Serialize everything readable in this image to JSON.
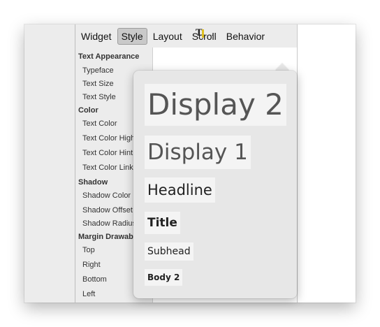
{
  "tabs": [
    {
      "label": "Widget"
    },
    {
      "label": "Style",
      "active": true
    },
    {
      "label": "Layout"
    },
    {
      "label": "Scroll"
    },
    {
      "label": "Behavior"
    }
  ],
  "properties": {
    "text_appearance": {
      "title": "Text Appearance",
      "items": [
        "Typeface",
        "Text Size",
        "Text Style"
      ]
    },
    "color": {
      "title": "Color",
      "items": [
        "Text Color",
        "Text Color High",
        "Text Color Hint",
        "Text Color Link"
      ]
    },
    "shadow": {
      "title": "Shadow",
      "items": [
        "Shadow Color",
        "Shadow Offset",
        "Shadow Radius"
      ]
    },
    "margin_drawable": {
      "title": "Margin Drawabl",
      "items": [
        "Top",
        "Right",
        "Bottom",
        "Left"
      ]
    }
  },
  "value_area": {
    "more_label": "…",
    "icons": [
      "text-appearance-icon",
      "more-icon"
    ]
  },
  "popup": {
    "options": [
      {
        "label": "Display 2"
      },
      {
        "label": "Display 1"
      },
      {
        "label": "Headline"
      },
      {
        "label": "Title"
      },
      {
        "label": "Subhead"
      },
      {
        "label": "Body 2"
      }
    ]
  },
  "colors": {
    "panel_bg": "#ececec",
    "popup_bg": "#e7e7e7",
    "option_bg": "#f4f4f4",
    "active_tab_bg": "#c9c9c9"
  }
}
